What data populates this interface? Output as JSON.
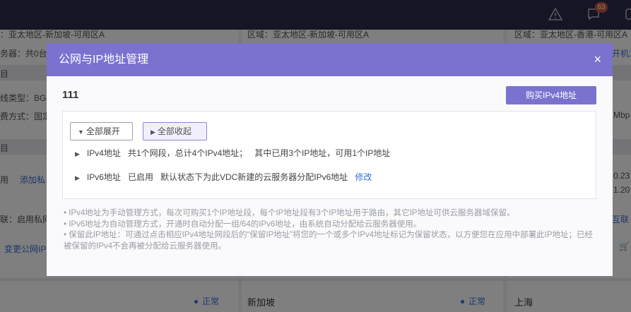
{
  "topbar": {
    "alert_icon": "warning-triangle-icon",
    "message_icon": "chat-bubble-icon",
    "message_count": "63",
    "help_icon": "help-icon"
  },
  "background": {
    "region1": "：亚太地区-新加坡-可用区A",
    "region2": "区域：亚太地区-新加坡-可用区A",
    "region3": "区域：亚太地区-香港-可用区A",
    "server_count": "务器：共0台",
    "open_machine": "开机1",
    "section1": "目",
    "line_type": "线类型：BGP",
    "bill_mode": "费方式：固定",
    "bandwidth": "Mbp",
    "section2": "目",
    "enabled": "用",
    "add_private": "添加私",
    "ip_a": "0.23",
    "ip_b": "1.20",
    "link": "联：启用私网",
    "interconnect": "互联",
    "change_public": "变更公网IP",
    "status_normal_1": "正常",
    "status_normal_2": "正常",
    "city_singapore": "新加坡",
    "city_shanghai": "上海"
  },
  "modal": {
    "title": "公网与IP地址管理",
    "close_label": "×",
    "vdc_name": "111",
    "buy_ipv4_label": "购买IPv4地址",
    "expand_all_label": "全部展开",
    "collapse_all_label": "全部收起",
    "ipv4": {
      "label": "IPv4地址",
      "summary": "共1个网段，总计4个IPv4地址；",
      "usage": "其中已用3个IP地址，可用1个IP地址"
    },
    "ipv6": {
      "label": "IPv6地址",
      "status": "已启用",
      "description": "默认状态下为此VDC新建的云服务器分配IPv6地址",
      "modify_label": "修改"
    },
    "notes": [
      "• IPv4地址为手动管理方式，每次可购买1个IP地址段，每个IP地址段有3个IP地址用于路由，其它IP地址可供云服务器域保留。",
      "• IPv6地址为自动管理方式，开通时自动分配一组/64的IPv6地址，由系统自动分配给云服务器使用。",
      "• 保留此IP地址：可通过点击相应IPv4地址网段后的“保留IP地址”将您的一个或多个IPv4地址标记为保留状态，以方便您在应用中部署此IP地址；已经被保留的IPv4不会再被分配给云服务器使用。"
    ]
  },
  "colors": {
    "accent": "#7b72cf",
    "topbar": "#2b2a4a",
    "link": "#3a6fd8",
    "badge": "#c8553d"
  }
}
